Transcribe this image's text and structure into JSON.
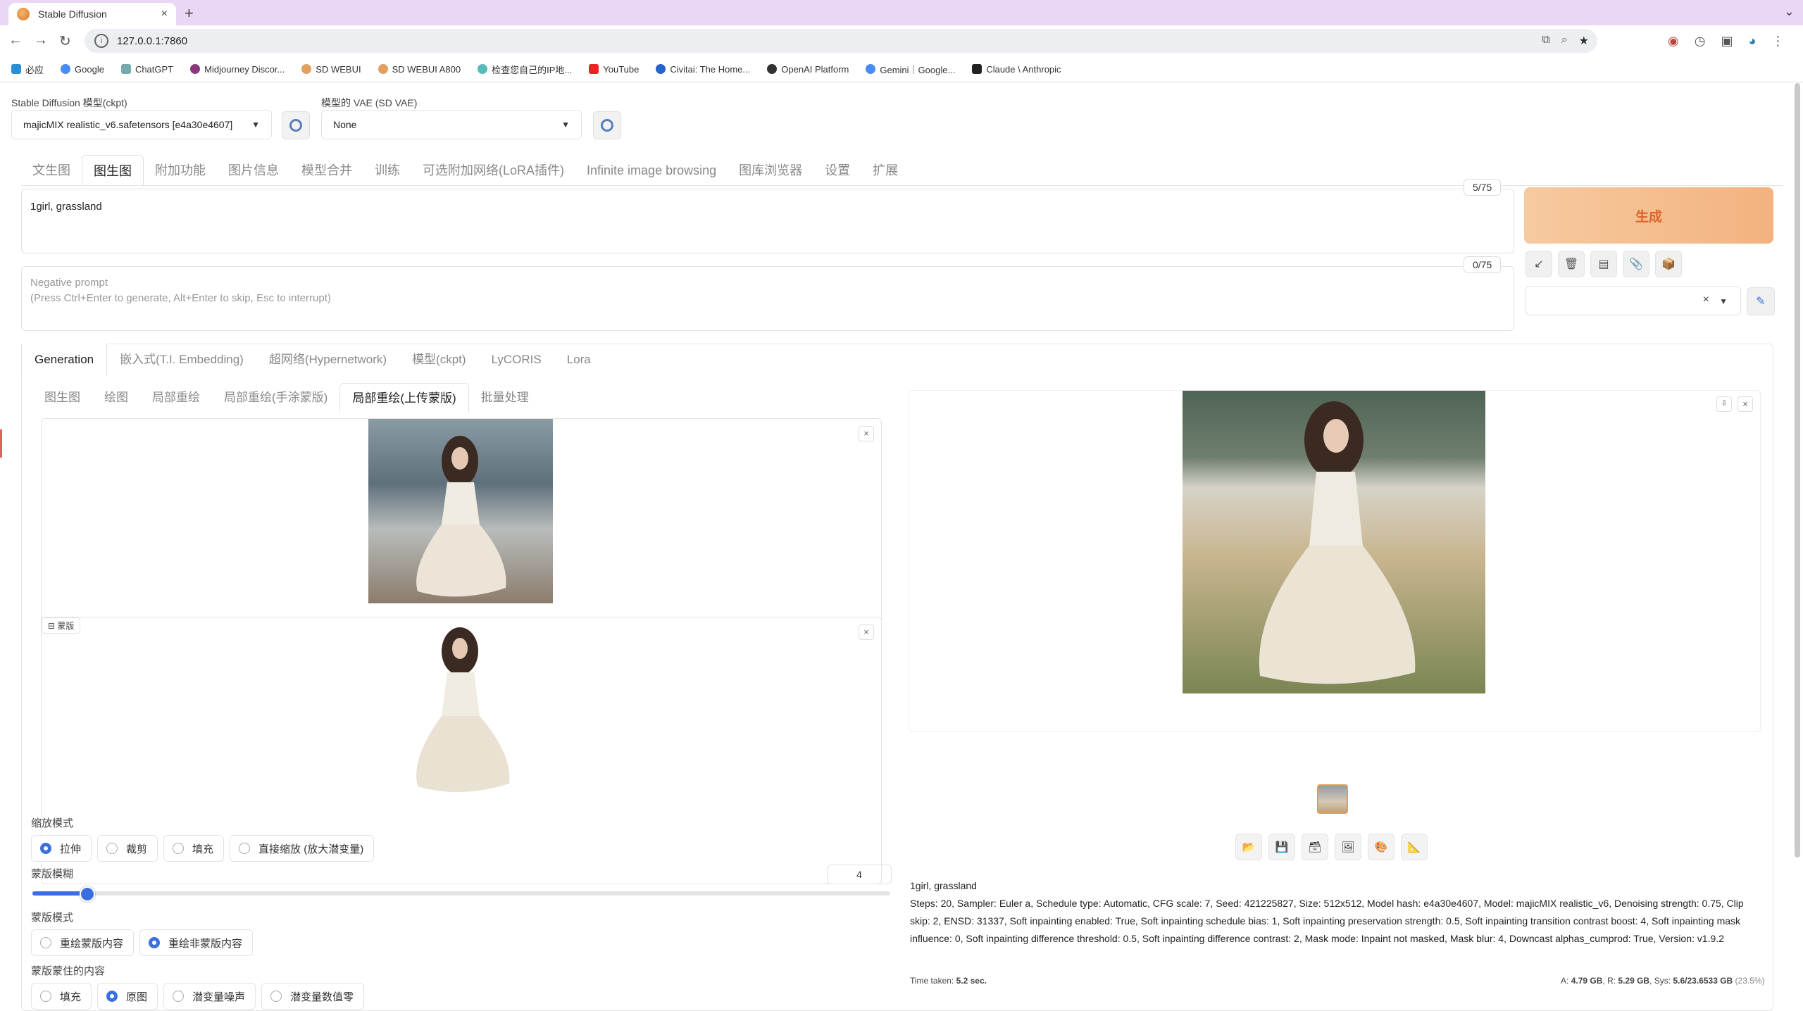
{
  "browser": {
    "tab_title": "Stable Diffusion",
    "tab_close": "×",
    "new_tab": "+",
    "tab_menu": "⌄",
    "url": "127.0.0.1:7860",
    "bookmarks": [
      "必应",
      "Google",
      "ChatGPT",
      "Midjourney Discor...",
      "SD WEBUI",
      "SD WEBUI A800",
      "检查您自己的IP地...",
      "YouTube",
      "Civitai: The Home...",
      "OpenAI Platform",
      "Gemini｜Google...",
      "Claude \\ Anthropic"
    ]
  },
  "top": {
    "ckpt_label": "Stable Diffusion 模型(ckpt)",
    "ckpt_value": "majicMIX realistic_v6.safetensors [e4a30e4607]",
    "vae_label": "模型的 VAE (SD VAE)",
    "vae_value": "None"
  },
  "main_tabs": [
    "文生图",
    "图生图",
    "附加功能",
    "图片信息",
    "模型合并",
    "训练",
    "可选附加网络(LoRA插件)",
    "Infinite image browsing",
    "图库浏览器",
    "设置",
    "扩展"
  ],
  "prompt": {
    "text": "1girl, grassland",
    "counter": "5/75",
    "negative_placeholder_1": "Negative prompt",
    "negative_placeholder_2": "(Press Ctrl+Enter to generate, Alt+Enter to skip, Esc to interrupt)",
    "negative_counter": "0/75"
  },
  "actions": {
    "generate": "生成"
  },
  "sub_tabs": [
    "Generation",
    "嵌入式(T.I. Embedding)",
    "超网络(Hypernetwork)",
    "模型(ckpt)",
    "LyCORIS",
    "Lora"
  ],
  "img2img_tabs": [
    "图生图",
    "绘图",
    "局部重绘",
    "局部重绘(手涂蒙版)",
    "局部重绘(上传蒙版)",
    "批量处理"
  ],
  "mask_label": "蒙版",
  "resize_mode": {
    "label": "缩放模式",
    "options": [
      "拉伸",
      "裁剪",
      "填充",
      "直接缩放 (放大潜变量)"
    ],
    "selected": 0
  },
  "mask_blur": {
    "label": "蒙版模糊",
    "value": "4",
    "fraction": 0.0625
  },
  "mask_mode": {
    "label": "蒙版模式",
    "options": [
      "重绘蒙版内容",
      "重绘非蒙版内容"
    ],
    "selected": 1
  },
  "masked_content": {
    "label": "蒙版蒙住的内容",
    "options": [
      "填充",
      "原图",
      "潜变量噪声",
      "潜变量数值零"
    ],
    "selected": 1
  },
  "output": {
    "prompt": "1girl, grassland",
    "params": "Steps: 20, Sampler: Euler a, Schedule type: Automatic, CFG scale: 7, Seed: 421225827, Size: 512x512, Model hash: e4a30e4607, Model: majicMIX realistic_v6, Denoising strength: 0.75, Clip skip: 2, ENSD: 31337, Soft inpainting enabled: True, Soft inpainting schedule bias: 1, Soft inpainting preservation strength: 0.5, Soft inpainting transition contrast boost: 4, Soft inpainting mask influence: 0, Soft inpainting difference threshold: 0.5, Soft inpainting difference contrast: 2, Mask mode: Inpaint not masked, Mask blur: 4, Downcast alphas_cumprod: True, Version: v1.9.2",
    "time_label": "Time taken:",
    "time_value": "5.2 sec.",
    "mem_a_label": "A:",
    "mem_a": "4.79 GB",
    "mem_r_label": "R:",
    "mem_r": "5.29 GB",
    "mem_sys_label": "Sys:",
    "mem_sys": "5.6/23.6533 GB",
    "mem_pct": "(23.5%)"
  },
  "colors": {
    "accent": "#3b6fe0",
    "generate_bg": "#f3b27f",
    "generate_text": "#d8642a",
    "tabbar": "#e9d7f5"
  }
}
